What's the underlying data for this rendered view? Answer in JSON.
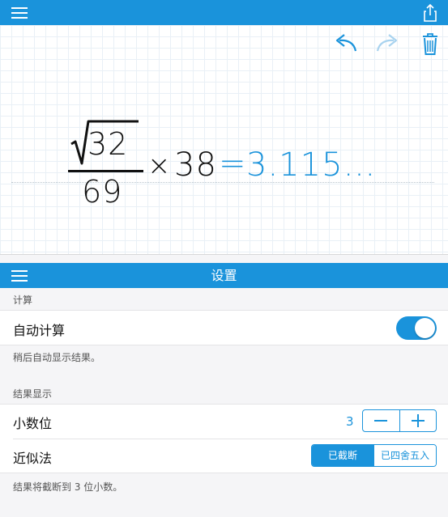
{
  "toolbar": {
    "menu_icon": "hamburger-menu-icon",
    "share_icon": "share-icon"
  },
  "canvas_tools": {
    "undo_icon": "undo-icon",
    "redo_icon": "redo-icon",
    "trash_icon": "trash-icon"
  },
  "expression": {
    "numerator": "32",
    "denominator": "69",
    "times": "×",
    "multiplier": "38",
    "equals": "=",
    "result": "3.115…"
  },
  "settings": {
    "title": "设置",
    "sections": {
      "calculation": {
        "header": "计算",
        "auto_calc_label": "自动计算",
        "auto_calc_on": true,
        "auto_calc_note": "稍后自动显示结果。"
      },
      "result_display": {
        "header": "结果显示",
        "decimals_label": "小数位",
        "decimals_value": "3",
        "approx_label": "近似法",
        "approx_options": [
          "已截断",
          "已四舍五入"
        ],
        "approx_selected": "已截断",
        "approx_note": "结果将截断到 3 位小数。"
      }
    }
  },
  "colors": {
    "accent": "#1a93db",
    "grid": "#e9f0f6",
    "panel_bg": "#f5f5f7"
  }
}
